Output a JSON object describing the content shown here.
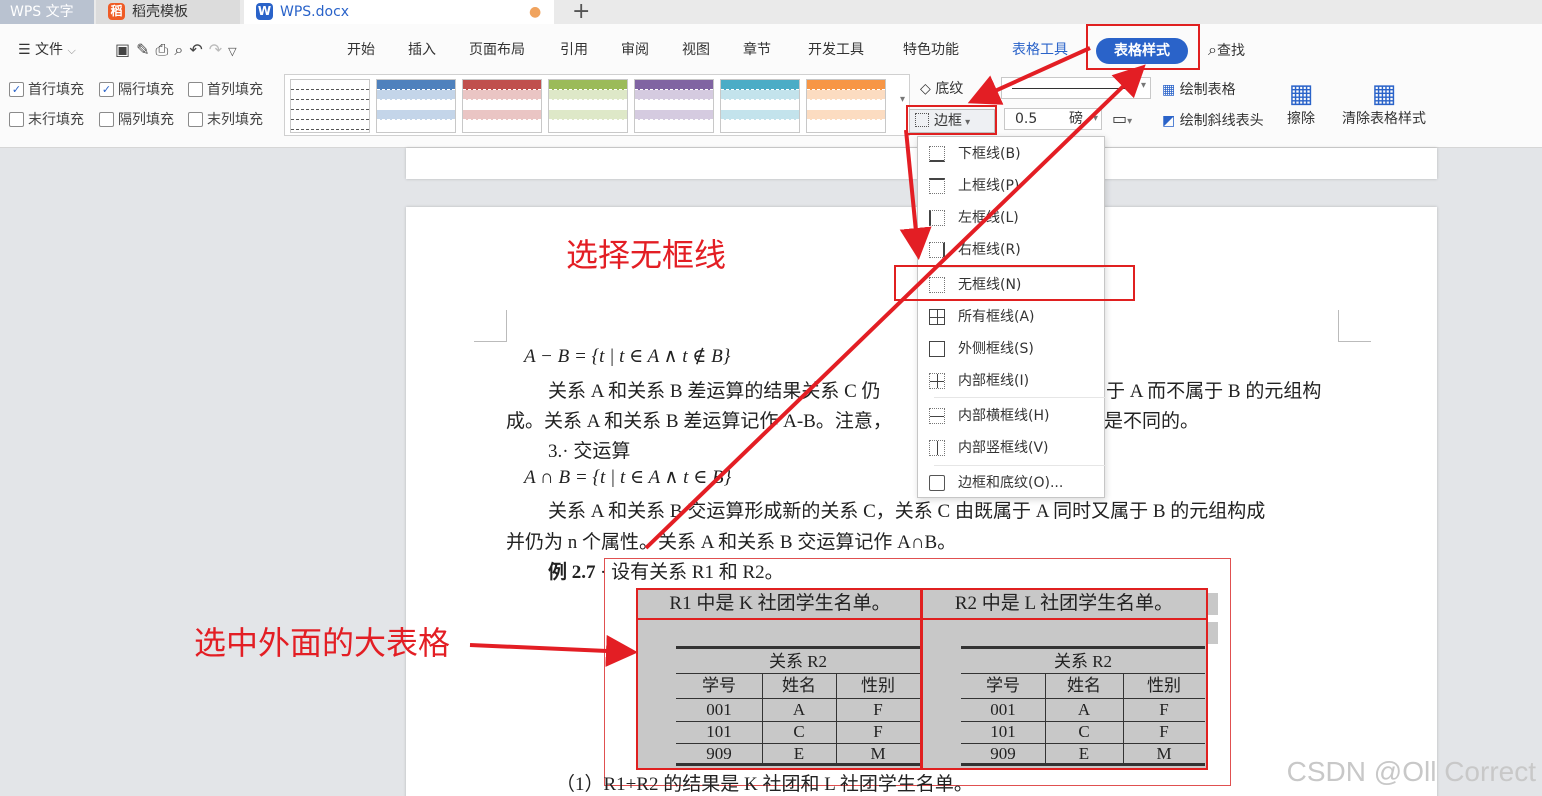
{
  "tabs": [
    {
      "label": "WPS 文字"
    },
    {
      "label": "稻壳模板"
    },
    {
      "label": "WPS.docx"
    }
  ],
  "new_tab": "+",
  "menus": [
    "文件",
    "开始",
    "插入",
    "页面布局",
    "引用",
    "审阅",
    "视图",
    "章节",
    "开发工具",
    "特色功能",
    "表格工具",
    "表格样式"
  ],
  "search": "查找",
  "checks": [
    {
      "label": "首行填充",
      "checked": true
    },
    {
      "label": "隔行填充",
      "checked": true
    },
    {
      "label": "首列填充",
      "checked": false
    },
    {
      "label": "末行填充",
      "checked": false
    },
    {
      "label": "隔列填充",
      "checked": false
    },
    {
      "label": "末列填充",
      "checked": false
    }
  ],
  "swatch_colors": [
    "#ffffff",
    "#4f81bd",
    "#c0504d",
    "#9bbb59",
    "#8064a2",
    "#4bacc6",
    "#f79646"
  ],
  "ribbon": {
    "shading": "底纹",
    "border": "边框",
    "width_value": "0.5",
    "width_unit": "磅",
    "draw_table": "绘制表格",
    "draw_diagonal": "绘制斜线表头",
    "erase": "擦除",
    "clear_style": "清除表格样式"
  },
  "dropdown": [
    "下框线(B)",
    "上框线(P)",
    "左框线(L)",
    "右框线(R)",
    "无框线(N)",
    "所有框线(A)",
    "外侧框线(S)",
    "内部框线(I)",
    "内部横框线(H)",
    "内部竖框线(V)",
    "边框和底纹(O)..."
  ],
  "annotations": {
    "select_none": "选择无框线",
    "select_outer": "选中外面的大表格"
  },
  "doc": {
    "formula1": "A − B = {t | t ∈ A ∧ t ∉ B}",
    "line1": "关系 A 和关系 B 差运算的结果关系 C 仍",
    "line1b": "于 A 而不属于 B 的元组构",
    "line2": "成。关系 A 和关系 B 差运算记作 A-B。注意，",
    "line2b": "是不同的。",
    "heading": "3.· 交运算",
    "formula2": "A ∩ B = {t | t ∈ A ∧ t ∈ B}",
    "line3": "关系 A 和关系 B 交运算形成新的关系 C，关系 C 由既属于 A 同时又属于 B 的元组构成",
    "line4": "并仍为 n 个属性。关系 A 和关系 B 交运算记作 A∩B。",
    "example_label": "例 2.7",
    "example_text": "· 设有关系 R1 和 R2。",
    "r1_header": "R1 中是 K 社团学生名单。",
    "r2_header": "R2 中是 L 社团学生名单。",
    "inner_title": "关系 R2",
    "inner_cols": [
      "学号",
      "姓名",
      "性别"
    ],
    "inner_rows": [
      [
        "001",
        "A",
        "F"
      ],
      [
        "101",
        "C",
        "F"
      ],
      [
        "909",
        "E",
        "M"
      ]
    ],
    "result_line": "（1）R1+R2 的结果是 K 社团和 L 社团学生名单。"
  },
  "watermark": "CSDN @Oll Correct"
}
